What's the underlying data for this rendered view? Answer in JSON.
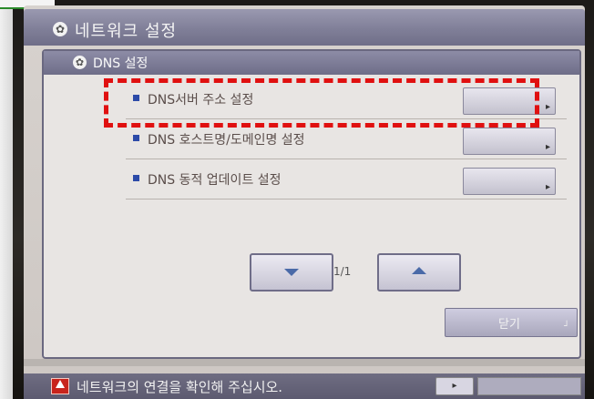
{
  "window": {
    "title": "네트워크 설정"
  },
  "panel": {
    "title": "DNS 설정"
  },
  "rows": [
    {
      "label": "DNS서버 주소 설정"
    },
    {
      "label": "DNS 호스트명/도메인명 설정"
    },
    {
      "label": "DNS 동적 업데이트 설정"
    }
  ],
  "pager": {
    "indicator": "1/1"
  },
  "close_button": {
    "label": "닫기"
  },
  "status_bar": {
    "message": "네트워크의 연결을 확인해 주십시오."
  },
  "colors": {
    "highlight": "#e01010",
    "bullet": "#2c4aa8",
    "title_bar": "#807f98",
    "warning": "#c8241c"
  },
  "icons": {
    "title": "settings-icon",
    "panel": "settings-icon",
    "down": "down-arrow-icon",
    "up": "up-arrow-icon",
    "warning": "warning-icon"
  }
}
